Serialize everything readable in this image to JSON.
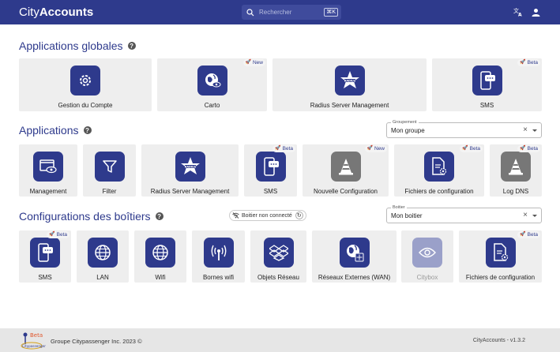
{
  "header": {
    "brand_light": "City",
    "brand_bold": "Accounts",
    "search_placeholder": "Rechercher",
    "search_shortcut": "⌘K"
  },
  "sections": {
    "global": {
      "title": "Applications globales",
      "cards": [
        {
          "label": "Gestion du Compte",
          "icon": "gear-icon"
        },
        {
          "label": "Carto",
          "icon": "globe-eye-icon",
          "badge": "New"
        },
        {
          "label": "Radius Server Management",
          "icon": "radius-star-icon"
        },
        {
          "label": "SMS",
          "icon": "sms-phone-icon",
          "badge": "Beta"
        }
      ]
    },
    "apps": {
      "title": "Applications",
      "select_label": "Groupement",
      "select_value": "Mon groupe",
      "cards": [
        {
          "label": "Management",
          "icon": "window-eye-icon"
        },
        {
          "label": "Filter",
          "icon": "filter-icon"
        },
        {
          "label": "Radius Server Management",
          "icon": "radius-star-icon"
        },
        {
          "label": "SMS",
          "icon": "sms-phone-icon",
          "badge": "Beta"
        },
        {
          "label": "Nouvelle Configuration",
          "icon": "traffic-cone-icon",
          "badge": "New"
        },
        {
          "label": "Fichiers de configuration",
          "icon": "file-gear-icon",
          "badge": "Beta"
        },
        {
          "label": "Log DNS",
          "icon": "traffic-cone-icon",
          "badge": "Beta"
        }
      ]
    },
    "boxes": {
      "title": "Configurations des boîtiers",
      "chip_label": "Boitier non connecté",
      "select_label": "Boitier",
      "select_value": "Mon boitier",
      "cards": [
        {
          "label": "SMS",
          "icon": "sms-phone-icon",
          "badge": "Beta"
        },
        {
          "label": "LAN",
          "icon": "globe-icon"
        },
        {
          "label": "Wifi",
          "icon": "globe-icon"
        },
        {
          "label": "Bornes wifi",
          "icon": "antenna-icon"
        },
        {
          "label": "Objets Réseau",
          "icon": "dropbox-icon"
        },
        {
          "label": "Réseaux Externes (WAN)",
          "icon": "globe-network-icon"
        },
        {
          "label": "Citybox",
          "icon": "eye-icon"
        },
        {
          "label": "Fichiers de configuration",
          "icon": "file-gear-icon",
          "badge": "Beta"
        }
      ]
    }
  },
  "footer": {
    "copyright": "Groupe Citypassenger Inc. 2023 ©",
    "version": "CityAccounts - v1.3.2",
    "logo_badge": "Beta",
    "logo_text": "Citypassenger"
  },
  "colors": {
    "primary": "#2e3a8c",
    "card_bg": "#eeeeee",
    "new_rocket": "#e0552b"
  }
}
